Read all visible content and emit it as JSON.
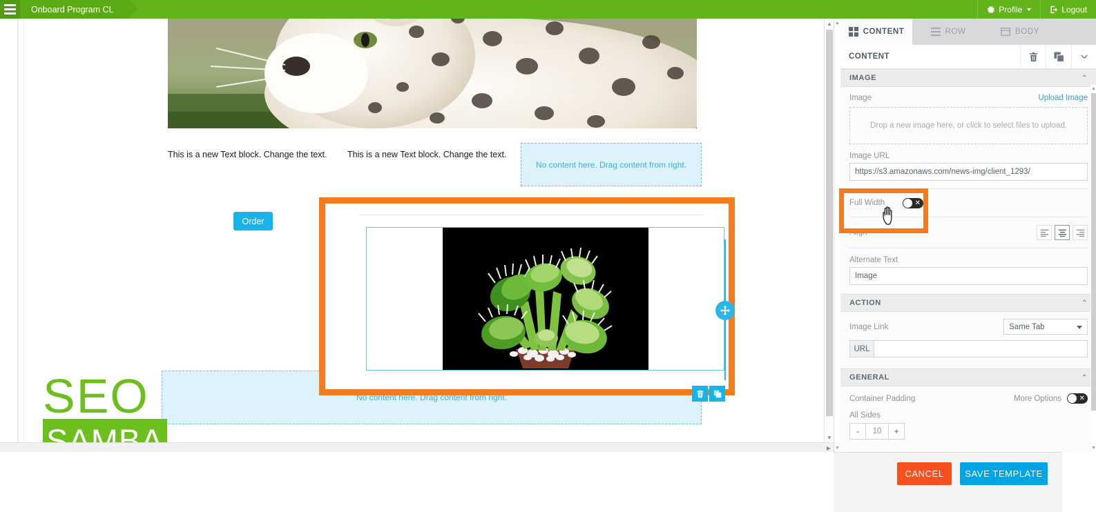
{
  "topbar": {
    "menu_icon": "hamburger-icon",
    "breadcrumb": "Onboard Program CL",
    "profile_label": "Profile",
    "profile_icon": "gear-icon",
    "logout_label": "Logout",
    "logout_icon": "logout-icon",
    "bg_color": "#63b31a"
  },
  "canvas": {
    "hero_image_alt": "snow-leopard-photo",
    "text_block_1": "This is a new Text block. Change the text.",
    "text_block_2": "This is a new Text block. Change the text.",
    "dropzone_top": "No content here. Drag content from right.",
    "dropzone_bottom": "No content here. Drag content from right.",
    "order_button": "Order",
    "selected_image_alt": "venus-flytrap-photo",
    "move_handle_icon": "move-icon",
    "delete_icon": "trash-icon",
    "duplicate_icon": "duplicate-icon",
    "logo_top": "SEO",
    "logo_bottom": "SAMBA",
    "logo_color": "#6cbf1c",
    "highlight_color": "#f47b20",
    "selection_color": "#29b6e8"
  },
  "panel": {
    "tabs": [
      {
        "label": "CONTENT",
        "icon": "grid-icon",
        "active": true
      },
      {
        "label": "ROW",
        "icon": "rows-icon",
        "active": false
      },
      {
        "label": "BODY",
        "icon": "body-icon",
        "active": false
      }
    ],
    "header": {
      "title": "CONTENT",
      "delete_icon": "trash-icon",
      "duplicate_icon": "duplicate-icon",
      "collapse_icon": "chevron-down-icon"
    },
    "image_section": {
      "title": "IMAGE",
      "collapse_icon": "chevron-up-icon",
      "image_label": "Image",
      "upload_link": "Upload Image",
      "dropzone_text": "Drop a new image here, or click to select files to upload.",
      "url_label": "Image URL",
      "url_value": "https://s3.amazonaws.com/news-img/client_1293/",
      "full_width_label": "Full Width",
      "full_width_on": false,
      "align_label": "Align",
      "align_options": [
        "align-left-icon",
        "align-center-icon",
        "align-right-icon"
      ],
      "align_selected": 1,
      "alt_label": "Alternate Text",
      "alt_value": "Image"
    },
    "action_section": {
      "title": "ACTION",
      "collapse_icon": "chevron-up-icon",
      "image_link_label": "Image Link",
      "image_link_value": "Same Tab",
      "url_tag": "URL",
      "url_value": "",
      "url_placeholder": ""
    },
    "general_section": {
      "title": "GENERAL",
      "collapse_icon": "chevron-up-icon",
      "container_padding_label": "Container Padding",
      "more_options_label": "More Options",
      "more_options_on": false,
      "all_sides_label": "All Sides",
      "minus": "-",
      "padding_value": "10",
      "plus": "+"
    }
  },
  "footer": {
    "cancel_label": "CANCEL",
    "save_label": "SAVE TEMPLATE",
    "cancel_color": "#f7501e",
    "save_color": "#00a5e5"
  }
}
